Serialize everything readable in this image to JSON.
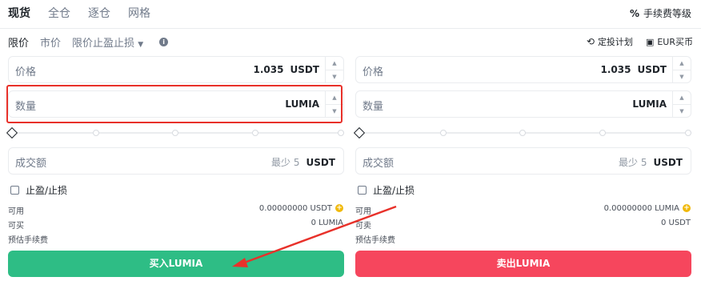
{
  "top_tabs": [
    "现货",
    "全仓",
    "逐仓",
    "网格"
  ],
  "fee_level": "手续费等级",
  "order_types": [
    "限价",
    "市价",
    "限价止盈止损"
  ],
  "right_links": {
    "dca": "定投计划",
    "eur_buy": "EUR买币"
  },
  "buy": {
    "price_label": "价格",
    "price_value": "1.035",
    "price_unit": "USDT",
    "qty_label": "数量",
    "qty_unit": "LUMIA",
    "total_label": "成交额",
    "total_hint": "最少 5",
    "total_unit": "USDT",
    "tpsl_label": "止盈/止损",
    "avail_label": "可用",
    "avail_value": "0.00000000 USDT",
    "can_label": "可买",
    "can_value": "0 LUMIA",
    "fee_label": "预估手续费",
    "button": "买入LUMIA"
  },
  "sell": {
    "price_label": "价格",
    "price_value": "1.035",
    "price_unit": "USDT",
    "qty_label": "数量",
    "qty_unit": "LUMIA",
    "total_label": "成交额",
    "total_hint": "最少 5",
    "total_unit": "USDT",
    "tpsl_label": "止盈/止损",
    "avail_label": "可用",
    "avail_value": "0.00000000 LUMIA",
    "can_label": "可卖",
    "can_value": "0 USDT",
    "fee_label": "预估手续费",
    "button": "卖出LUMIA"
  },
  "colors": {
    "buy": "#2ebd85",
    "sell": "#f6465d",
    "highlight": "#e8312a"
  }
}
